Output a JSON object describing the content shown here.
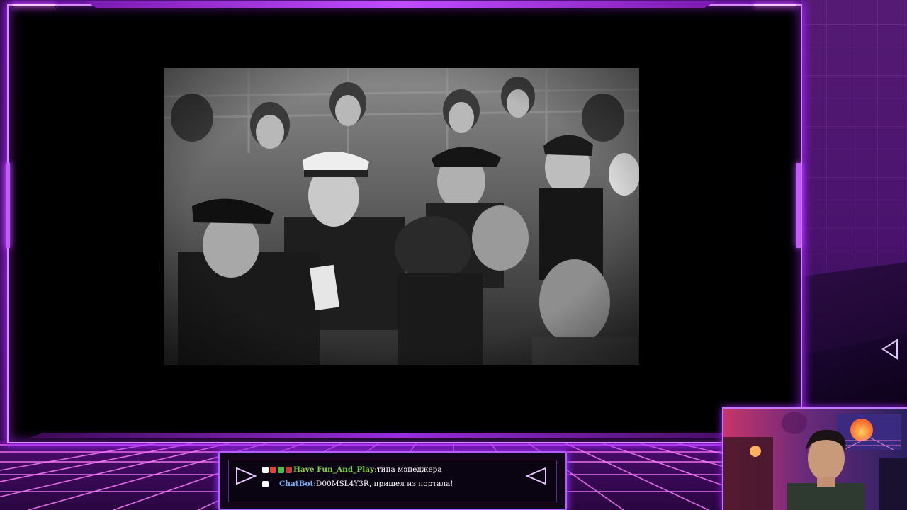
{
  "overlay": {
    "accent_color": "#b55cff",
    "glow_color": "#a020ff"
  },
  "video": {
    "content": "black-and-white crowd footage"
  },
  "chat": {
    "messages": [
      {
        "badges": [
          "bot-badge",
          "heart-badge",
          "check-badge",
          "flag-badge"
        ],
        "user": "Have Fun_And_Play",
        "separator": ":",
        "text": " типа мэнеджера",
        "user_color": "#7fcf3a"
      },
      {
        "badges": [
          "bot-badge"
        ],
        "user": "ChatBot",
        "separator": ":",
        "text": " D00MSL4Y3R, пришел из портала!",
        "user_color": "#6ab0ff"
      }
    ],
    "left_arrow_icon": "play-triangle-icon",
    "right_arrow_icon": "back-triangle-icon"
  },
  "webcam": {
    "content": "streamer webcam"
  }
}
